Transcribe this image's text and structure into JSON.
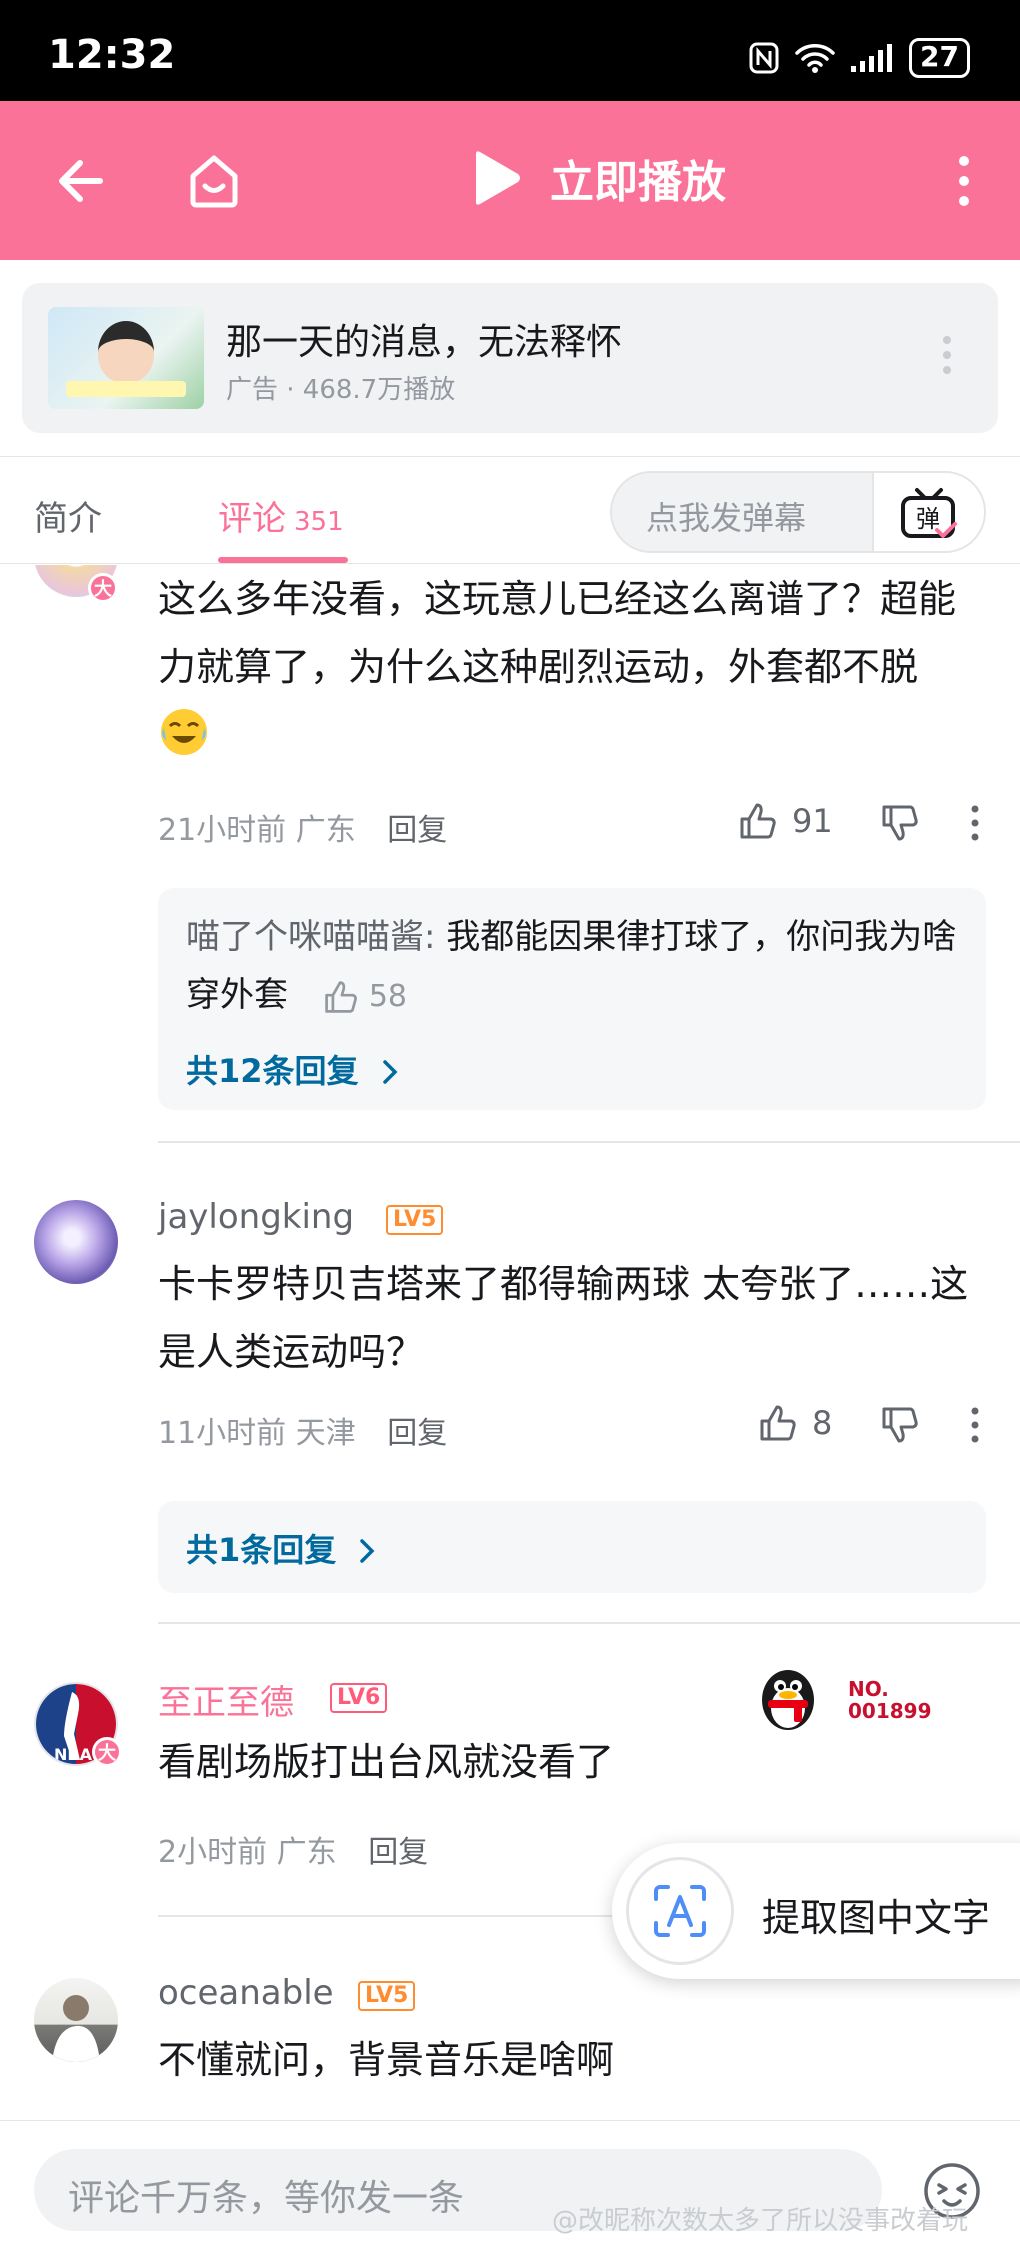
{
  "status_bar": {
    "time": "12:32",
    "battery": "27"
  },
  "top_bar": {
    "play_label": "立即播放"
  },
  "ad": {
    "title": "那一天的消息，无法释怀",
    "meta": "广告 · 468.7万播放"
  },
  "tabs": {
    "intro": "简介",
    "comments": "评论",
    "comments_count": "351",
    "danmaku_placeholder": "点我发弹幕",
    "danmaku_icon_char": "弹"
  },
  "comments": [
    {
      "text": "这么多年没看，这玩意儿已经这么离谱了？超能力就算了，为什么这种剧烈运动，外套都不脱",
      "time": "21小时前",
      "location": "广东",
      "reply_label": "回复",
      "likes": "91",
      "reply": {
        "author": "喵了个咪喵喵酱:",
        "text": "我都能因果律打球了，你问我为啥穿外套",
        "likes": "58"
      },
      "more_replies": "共12条回复"
    },
    {
      "username": "jaylongking",
      "level": "LV5",
      "text": "卡卡罗特贝吉塔来了都得输两球  太夸张了……这是人类运动吗？",
      "time": "11小时前",
      "location": "天津",
      "reply_label": "回复",
      "likes": "8",
      "more_replies": "共1条回复"
    },
    {
      "username": "至正至德",
      "level": "LV6",
      "text": "看剧场版打出台风就没看了",
      "time": "2小时前",
      "location": "广东",
      "reply_label": "回复",
      "medal": "NO.\n001899",
      "avatar_text": "NBA"
    },
    {
      "username": "oceanable",
      "level": "LV5",
      "text": "不懂就问，背景音乐是啥啊"
    }
  ],
  "badge_big": "大",
  "ocr": {
    "label": "提取图中文字"
  },
  "bottom": {
    "placeholder": "评论千万条，等你发一条"
  },
  "watermark": "@改昵称次数太多了所以没事改着玩",
  "colors": {
    "brand_pink": "#fb7299",
    "link_blue": "#00699d",
    "level_orange": "#ff8c2f"
  }
}
